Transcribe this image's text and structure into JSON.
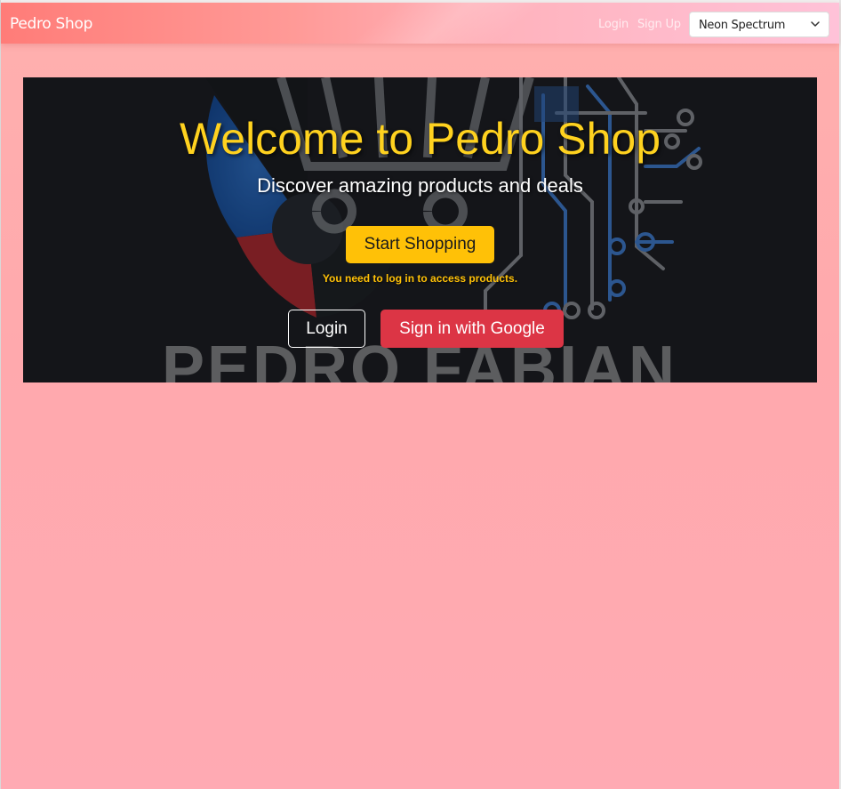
{
  "navbar": {
    "brand": "Pedro Shop",
    "login_label": "Login",
    "signup_label": "Sign Up",
    "theme_select": {
      "selected": "Neon Spectrum",
      "icon": "chevron-down-icon"
    }
  },
  "hero": {
    "background_logo_text": "PEDRO FABIAN",
    "title": "Welcome to Pedro Shop",
    "subtitle": "Discover amazing products and deals",
    "start_button_label": "Start Shopping",
    "login_notice": "You need to log in to access products.",
    "login_button_label": "Login",
    "google_button_label": "Sign in with Google"
  },
  "colors": {
    "accent_yellow": "#ffc107",
    "title_yellow": "#ffd21f",
    "google_red": "#dc3545",
    "page_bg": "#ffaaad",
    "hero_bg": "#17181c"
  }
}
